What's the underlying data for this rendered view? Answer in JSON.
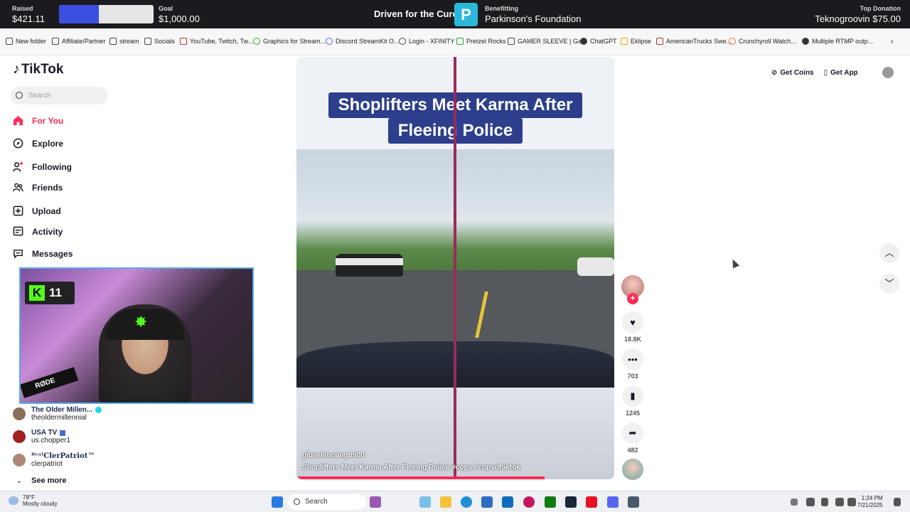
{
  "donation": {
    "raised_label": "Raised",
    "raised_value": "$421.11",
    "goal_label": "Goal",
    "goal_value": "$1,000.00",
    "progress_fraction": 0.421,
    "cause": "Driven for the Cure!",
    "benefitting_label": "Benefitting",
    "benefitting_org": "Parkinson's Foundation",
    "top_donation_label": "Top Donation",
    "top_donation_value": "Teknogroovin $75.00",
    "logo_letter": "P"
  },
  "bookmarks": [
    "New folder",
    "Affiliate/Partner",
    "stream",
    "Socials",
    "YouTube, Twitch, Tw...",
    "Graphics for Stream...",
    "Discord StreamKit O...",
    "Login - XFINITY",
    "Pretzel Rocks",
    "GAMER SLEEVE | Ga...",
    "ChatGPT",
    "Eklipse",
    "AmericanTrucks Swe...",
    "Crunchyroll Watch...",
    "Multiple RTMP outp..."
  ],
  "tiktok": {
    "logo_text": "TikTok",
    "search_placeholder": "Search",
    "nav": [
      {
        "label": "For You",
        "icon": "home-icon"
      },
      {
        "label": "Explore",
        "icon": "compass-icon"
      },
      {
        "label": "Following",
        "icon": "following-icon"
      },
      {
        "label": "Friends",
        "icon": "friends-icon"
      },
      {
        "label": "Upload",
        "icon": "upload-icon"
      },
      {
        "label": "Activity",
        "icon": "activity-icon"
      },
      {
        "label": "Messages",
        "icon": "messages-icon"
      }
    ],
    "accounts": [
      {
        "name": "The Older Millen...",
        "user": "theoldermillennial"
      },
      {
        "name": "USA TV",
        "user": "us.chopper1"
      },
      {
        "name": "ᴿᵉᵃˡClerPatriot™",
        "user": "clerpatriot"
      }
    ],
    "see_more": "See more",
    "get_coins": "Get Coins",
    "get_app": "Get App"
  },
  "webcam": {
    "badge_letter": "K",
    "badge_number": "11",
    "mic_label": "RØDE"
  },
  "video": {
    "title_line1": "Shoplifters Meet Karma After",
    "title_line2": "Fleeing Police",
    "username": "giuselehoangthi00",
    "caption": "Shoplifters Meet Karma After Fleeing Police #cops #copsoftiktok",
    "progress_fraction": 0.78,
    "likes": "18.8K",
    "comments": "703",
    "saves": "1245",
    "shares": "482"
  },
  "taskbar": {
    "temperature": "78°F",
    "weather": "Mostly cloudy",
    "search_label": "Search",
    "time": "1:24 PM",
    "date": "7/21/2025"
  },
  "colors": {
    "tiktok_accent": "#fe2c55",
    "progress_fill": "#3a4fe0",
    "video_title_bg": "#2d3e8c"
  }
}
